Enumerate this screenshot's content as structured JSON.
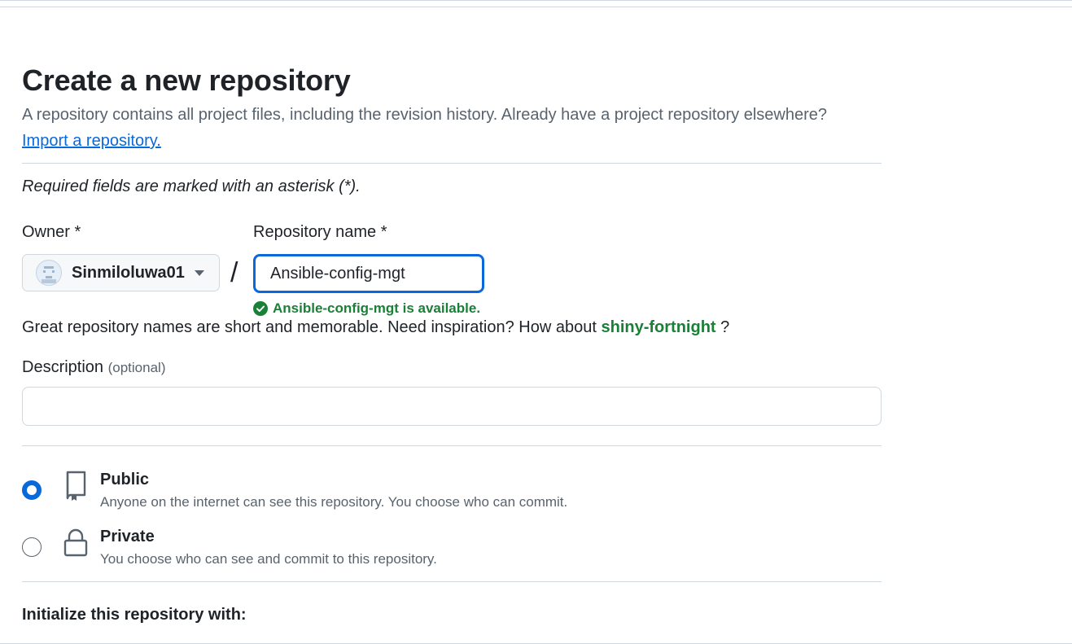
{
  "page": {
    "title": "Create a new repository",
    "subtitle": "A repository contains all project files, including the revision history. Already have a project repository elsewhere?",
    "import_link": "Import a repository.",
    "required_note": "Required fields are marked with an asterisk (*)."
  },
  "owner": {
    "label": "Owner *",
    "value": "Sinmiloluwa01",
    "icon": "chevron-down-icon"
  },
  "repo": {
    "label": "Repository name *",
    "value": "Ansible-config-mgt",
    "availability": "Ansible-config-mgt is available.",
    "status_color": "#1a7f37"
  },
  "separator": "/",
  "inspiration": {
    "text": "Great repository names are short and memorable. Need inspiration? How about",
    "suggestion": "shiny-fortnight",
    "suffix": "?"
  },
  "description": {
    "label": "Description",
    "optional": "(optional)",
    "value": ""
  },
  "visibility": {
    "selected": "public",
    "options": [
      {
        "title": "Public",
        "desc": "Anyone on the internet can see this repository. You choose who can commit.",
        "icon": "repo-icon"
      },
      {
        "title": "Private",
        "desc": "You choose who can see and commit to this repository.",
        "icon": "lock-icon"
      }
    ]
  },
  "initialize": {
    "label": "Initialize this repository with:"
  },
  "colors": {
    "accent": "#0969da",
    "success": "#1a7f37",
    "muted": "#59636e",
    "border": "#d0d7de"
  }
}
